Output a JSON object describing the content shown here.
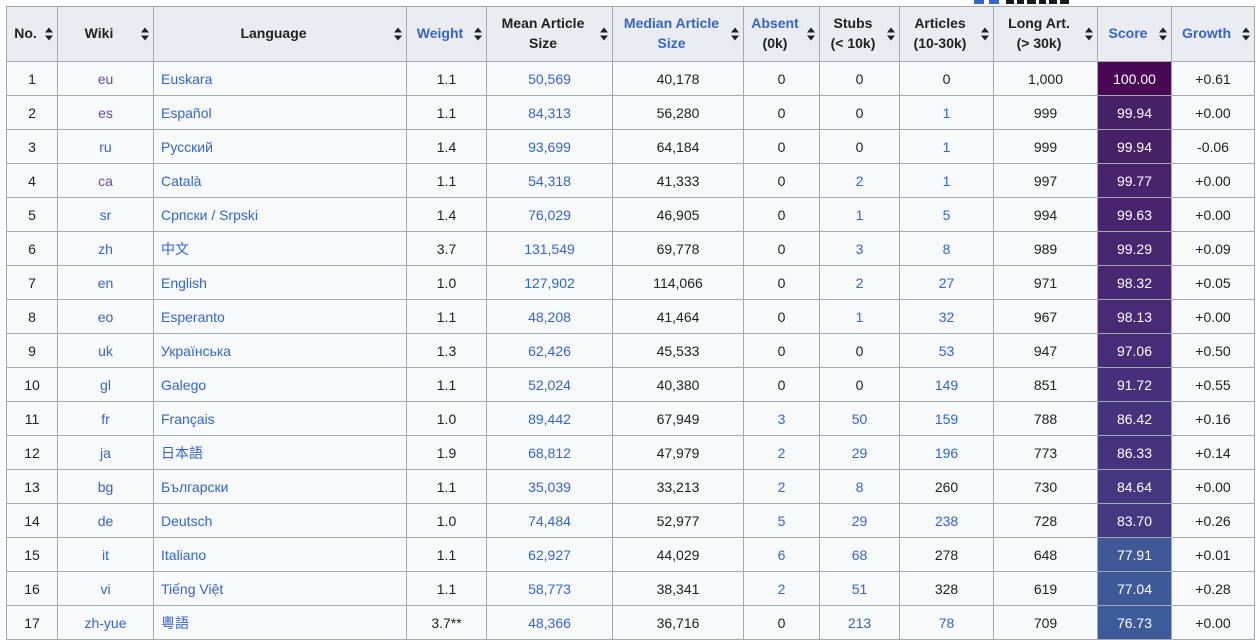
{
  "table": {
    "columns": [
      {
        "id": "no",
        "label": "No.",
        "link": false
      },
      {
        "id": "wiki",
        "label": "Wiki",
        "link": false
      },
      {
        "id": "language",
        "label": "Language",
        "link": false
      },
      {
        "id": "weight",
        "label": "Weight",
        "link": true
      },
      {
        "id": "mean",
        "label": "Mean Article Size",
        "link": false
      },
      {
        "id": "median",
        "label": "Median Article Size",
        "link": true
      },
      {
        "id": "absent",
        "label": "Absent",
        "sub": "(0k)",
        "link": true,
        "sub_link": false
      },
      {
        "id": "stubs",
        "label": "Stubs",
        "sub": "(< 10k)",
        "link": false,
        "sub_link": false
      },
      {
        "id": "articles",
        "label": "Articles",
        "sub": "(10-30k)",
        "link": false,
        "sub_link": false
      },
      {
        "id": "longart",
        "label": "Long Art.",
        "sub": "(> 30k)",
        "link": false,
        "sub_link": false
      },
      {
        "id": "score",
        "label": "Score",
        "link": true
      },
      {
        "id": "growth",
        "label": "Growth",
        "link": true
      }
    ],
    "rows": [
      {
        "no": "1",
        "wiki": "eu",
        "wiki_visited": true,
        "language": "Euskara",
        "weight": "1.1",
        "mean": "50,569",
        "median": "40,178",
        "absent": "0",
        "absent_link": false,
        "stubs": "0",
        "stubs_link": false,
        "articles": "0",
        "articles_link": false,
        "longart": "1,000",
        "score": "100.00",
        "score_bg": "#480854",
        "growth": "+0.61"
      },
      {
        "no": "2",
        "wiki": "es",
        "wiki_visited": true,
        "language": "Español",
        "weight": "1.1",
        "mean": "84,313",
        "median": "56,280",
        "absent": "0",
        "absent_link": false,
        "stubs": "0",
        "stubs_link": false,
        "articles": "1",
        "articles_link": true,
        "longart": "999",
        "score": "99.94",
        "score_bg": "#472167",
        "growth": "+0.00"
      },
      {
        "no": "3",
        "wiki": "ru",
        "wiki_visited": false,
        "language": "Русский",
        "weight": "1.4",
        "mean": "93,699",
        "median": "64,184",
        "absent": "0",
        "absent_link": false,
        "stubs": "0",
        "stubs_link": false,
        "articles": "1",
        "articles_link": true,
        "longart": "999",
        "score": "99.94",
        "score_bg": "#472168",
        "growth": "-0.06"
      },
      {
        "no": "4",
        "wiki": "ca",
        "wiki_visited": true,
        "language": "Català",
        "weight": "1.1",
        "mean": "54,318",
        "median": "41,333",
        "absent": "0",
        "absent_link": false,
        "stubs": "2",
        "stubs_link": true,
        "articles": "1",
        "articles_link": true,
        "longart": "997",
        "score": "99.77",
        "score_bg": "#47236b",
        "growth": "+0.00"
      },
      {
        "no": "5",
        "wiki": "sr",
        "wiki_visited": false,
        "language": "Српски / Srpski",
        "weight": "1.4",
        "mean": "76,029",
        "median": "46,905",
        "absent": "0",
        "absent_link": false,
        "stubs": "1",
        "stubs_link": true,
        "articles": "5",
        "articles_link": true,
        "longart": "994",
        "score": "99.63",
        "score_bg": "#47246d",
        "growth": "+0.00"
      },
      {
        "no": "6",
        "wiki": "zh",
        "wiki_visited": false,
        "language": "中文",
        "weight": "3.7",
        "mean": "131,549",
        "median": "69,778",
        "absent": "0",
        "absent_link": false,
        "stubs": "3",
        "stubs_link": true,
        "articles": "8",
        "articles_link": true,
        "longart": "989",
        "score": "99.29",
        "score_bg": "#472670",
        "growth": "+0.09"
      },
      {
        "no": "7",
        "wiki": "en",
        "wiki_visited": false,
        "language": "English",
        "weight": "1.0",
        "mean": "127,902",
        "median": "114,066",
        "absent": "0",
        "absent_link": false,
        "stubs": "2",
        "stubs_link": true,
        "articles": "27",
        "articles_link": true,
        "longart": "971",
        "score": "98.32",
        "score_bg": "#482873",
        "growth": "+0.05"
      },
      {
        "no": "8",
        "wiki": "eo",
        "wiki_visited": false,
        "language": "Esperanto",
        "weight": "1.1",
        "mean": "48,208",
        "median": "41,464",
        "absent": "0",
        "absent_link": false,
        "stubs": "1",
        "stubs_link": true,
        "articles": "32",
        "articles_link": true,
        "longart": "967",
        "score": "98.13",
        "score_bg": "#482974",
        "growth": "+0.00"
      },
      {
        "no": "9",
        "wiki": "uk",
        "wiki_visited": false,
        "language": "Українська",
        "weight": "1.3",
        "mean": "62,426",
        "median": "45,533",
        "absent": "0",
        "absent_link": false,
        "stubs": "0",
        "stubs_link": false,
        "articles": "53",
        "articles_link": true,
        "longart": "947",
        "score": "97.06",
        "score_bg": "#472c77",
        "growth": "+0.50"
      },
      {
        "no": "10",
        "wiki": "gl",
        "wiki_visited": false,
        "language": "Galego",
        "weight": "1.1",
        "mean": "52,024",
        "median": "40,380",
        "absent": "0",
        "absent_link": false,
        "stubs": "0",
        "stubs_link": false,
        "articles": "149",
        "articles_link": true,
        "longart": "851",
        "score": "91.72",
        "score_bg": "#46307a",
        "growth": "+0.55"
      },
      {
        "no": "11",
        "wiki": "fr",
        "wiki_visited": false,
        "language": "Français",
        "weight": "1.0",
        "mean": "89,442",
        "median": "67,949",
        "absent": "3",
        "absent_link": true,
        "stubs": "50",
        "stubs_link": true,
        "articles": "159",
        "articles_link": true,
        "longart": "788",
        "score": "86.42",
        "score_bg": "#45337c",
        "growth": "+0.16"
      },
      {
        "no": "12",
        "wiki": "ja",
        "wiki_visited": false,
        "language": "日本語",
        "weight": "1.9",
        "mean": "68,812",
        "median": "47,979",
        "absent": "2",
        "absent_link": true,
        "stubs": "29",
        "stubs_link": true,
        "articles": "196",
        "articles_link": true,
        "longart": "773",
        "score": "86.33",
        "score_bg": "#45347d",
        "growth": "+0.14"
      },
      {
        "no": "13",
        "wiki": "bg",
        "wiki_visited": false,
        "language": "Български",
        "weight": "1.1",
        "mean": "35,039",
        "median": "33,213",
        "absent": "2",
        "absent_link": true,
        "stubs": "8",
        "stubs_link": true,
        "articles": "260",
        "articles_link": false,
        "longart": "730",
        "score": "84.64",
        "score_bg": "#44377f",
        "growth": "+0.00"
      },
      {
        "no": "14",
        "wiki": "de",
        "wiki_visited": false,
        "language": "Deutsch",
        "weight": "1.0",
        "mean": "74,484",
        "median": "52,977",
        "absent": "5",
        "absent_link": true,
        "stubs": "29",
        "stubs_link": true,
        "articles": "238",
        "articles_link": true,
        "longart": "728",
        "score": "83.70",
        "score_bg": "#443880",
        "growth": "+0.26"
      },
      {
        "no": "15",
        "wiki": "it",
        "wiki_visited": false,
        "language": "Italiano",
        "weight": "1.1",
        "mean": "62,927",
        "median": "44,029",
        "absent": "6",
        "absent_link": true,
        "stubs": "68",
        "stubs_link": true,
        "articles": "278",
        "articles_link": false,
        "longart": "648",
        "score": "77.91",
        "score_bg": "#3f5896",
        "growth": "+0.01"
      },
      {
        "no": "16",
        "wiki": "vi",
        "wiki_visited": false,
        "language": "Tiếng Việt",
        "weight": "1.1",
        "mean": "58,773",
        "median": "38,341",
        "absent": "2",
        "absent_link": true,
        "stubs": "51",
        "stubs_link": true,
        "articles": "328",
        "articles_link": false,
        "longart": "619",
        "score": "77.04",
        "score_bg": "#3e5998",
        "growth": "+0.28"
      },
      {
        "no": "17",
        "wiki": "zh-yue",
        "wiki_visited": false,
        "language": "粵語",
        "weight": "3.7**",
        "mean": "48,366",
        "median": "36,716",
        "absent": "0",
        "absent_link": false,
        "stubs": "213",
        "stubs_link": true,
        "articles": "78",
        "articles_link": true,
        "longart": "709",
        "score": "76.73",
        "score_bg": "#3d5a99",
        "growth": "+0.00"
      }
    ]
  },
  "colors": {
    "link_blue": "#3366cc",
    "visited_purple": "#6b4ba1",
    "header_bg": "#eaecf0",
    "row_bg": "#f8f9fa",
    "border": "#a2a9b1",
    "text": "#202122",
    "score_text": "#ffffff"
  }
}
